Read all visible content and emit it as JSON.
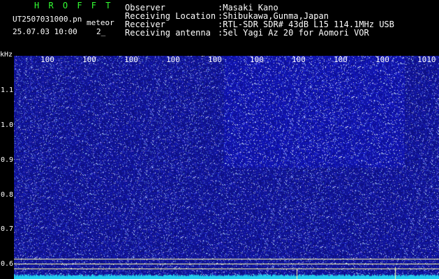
{
  "header": {
    "app_title": "H R O F F T",
    "file_name": "UT2507031000.pn",
    "meteor_label": "meteor",
    "datetime": "25.07.03 10:00",
    "meteor_count": "2_"
  },
  "station_info": [
    {
      "key": "Observer",
      "value": ":Masaki Kano"
    },
    {
      "key": "Receiving Location",
      "value": ":Shibukawa,Gunma,Japan"
    },
    {
      "key": "Receiver",
      "value": ":RTL-SDR SDR# 43dB L15 114.1MHz USB"
    },
    {
      "key": "Receiving antenna",
      "value": ":5el Yagi Az 20 for Aomori VOR"
    }
  ],
  "axes": {
    "y_unit": "kHz",
    "y_ticks": [
      "1.1",
      "1.0",
      "0.9",
      "0.8",
      "0.7",
      "0.6"
    ],
    "x_ticks": [
      "100",
      "100",
      "100",
      "100",
      "100",
      "100",
      "100",
      "100",
      "100",
      "100",
      "1010"
    ]
  },
  "colors": {
    "background": "#000000",
    "spectrogram_bg": "#1a1a8c",
    "noise_dots": "#9aa8ff",
    "signal_band": "#22ccee",
    "title_green": "#33ff33",
    "guide_lines": "#ffffaa"
  }
}
